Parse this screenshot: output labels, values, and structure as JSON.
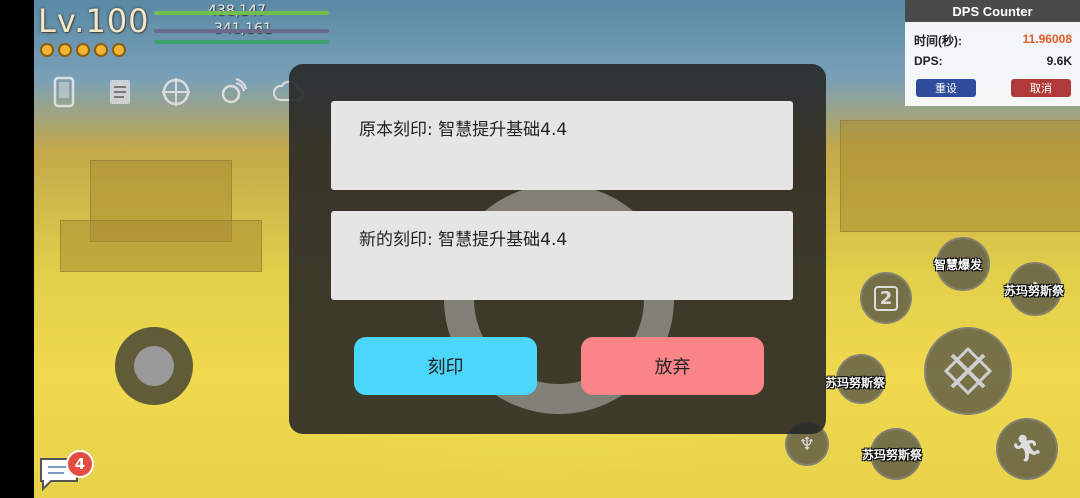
{
  "hud": {
    "level": "Lv.100",
    "hp": "438,147",
    "mp": "341,161",
    "coins": 5,
    "icons": [
      "phone-icon",
      "scroll-icon",
      "target-icon",
      "signal-icon",
      "cloud-icon"
    ]
  },
  "dps_counter": {
    "title": "DPS Counter",
    "time_label": "时间(秒):",
    "time_value": "11.96008",
    "dps_label": "DPS:",
    "dps_value": "9.6K",
    "reset_label": "重设",
    "cancel_label": "取消",
    "reset_color": "#2f4c9c",
    "cancel_color": "#b03a3a"
  },
  "dialog": {
    "original_imprint": "原本刻印: 智慧提升基础4.4",
    "new_imprint": "新的刻印: 智慧提升基础4.4",
    "imprint_button": "刻印",
    "discard_button": "放弃",
    "imprint_color": "#4dd6fb",
    "discard_color": "#fb8489"
  },
  "skills": {
    "wisdom_burst": "智慧爆发",
    "sumanusi_1": "苏玛努斯祭",
    "sumanusi_2": "苏玛努斯祭",
    "sumanusi_3": "苏玛努斯祭",
    "slot_number": "2"
  },
  "chat": {
    "badge_count": "4"
  }
}
